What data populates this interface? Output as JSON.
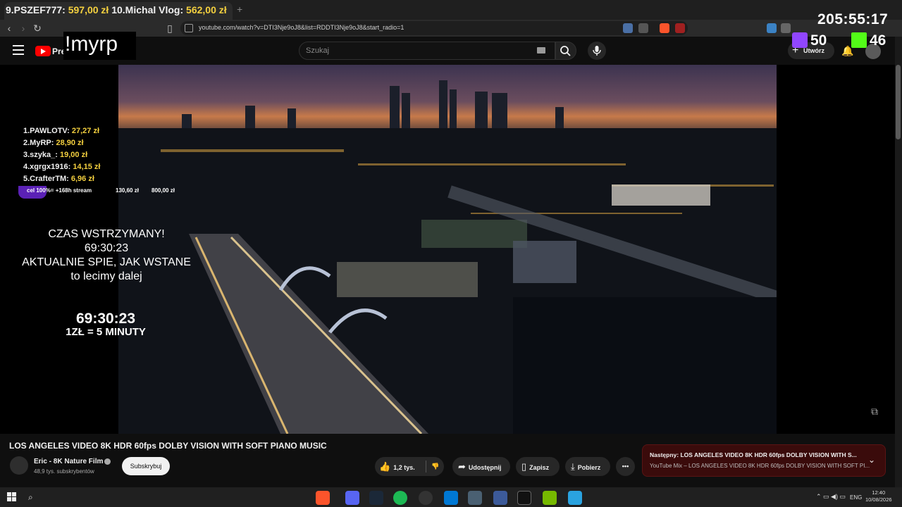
{
  "browser": {
    "url": "youtube.com/watch?v=DTI3Nje9oJ8&list=RDDTI3Nje9oJ8&start_radio=1",
    "new_tab": "+"
  },
  "youtube": {
    "logo_text": "Pre",
    "search_placeholder": "Szukaj",
    "create_label": "Utwórz"
  },
  "overlay": {
    "command": "!myrp",
    "clock": "205:55:17",
    "twitch_viewers": "50",
    "kick_viewers": "46",
    "top_ticker": [
      {
        "name": "9.PSZEF777:",
        "amount": "597,00 zł"
      },
      {
        "name": "10.Michal Vlog:",
        "amount": "562,00 zł"
      }
    ],
    "leaderboard": [
      {
        "name": "1.PAWLOTV:",
        "amount": "27,27 zł"
      },
      {
        "name": "2.MyRP:",
        "amount": "28,90 zł"
      },
      {
        "name": "3.szyka_:",
        "amount": "19,00 zł"
      },
      {
        "name": "4.xgrgx1916:",
        "amount": "14,15 zł"
      },
      {
        "name": "5.CrafterTM:",
        "amount": "6,96 zł"
      }
    ],
    "goal": {
      "label": "cel 100%= +168h stream",
      "current": "130,60 zł",
      "target": "800,00 zł",
      "progress": 0.163
    },
    "pause_lines": [
      "CZAS WSTRZYMANY!",
      "69:30:23",
      "AKTUALNIE SPIE, JAK WSTANE",
      "to lecimy dalej"
    ],
    "timer": "69:30:23",
    "rate": "1ZŁ = 5 MINUTY"
  },
  "video": {
    "title": "LOS ANGELES VIDEO 8K HDR 60fps DOLBY VISION WITH SOFT PIANO MUSIC",
    "channel": "Eric - 8K Nature Film",
    "subscribers": "48,9 tys. subskrybentów",
    "subscribe_label": "Subskrybuj",
    "likes": "1,2 tys.",
    "share_label": "Udostępnij",
    "save_label": "Zapisz",
    "download_label": "Pobierz",
    "more_label": "•••"
  },
  "up_next": {
    "line1": "Następny: LOS ANGELES VIDEO 8K HDR 60fps DOLBY VISION WITH S...",
    "line2": "YouTube Mix – LOS ANGELES VIDEO 8K HDR 60fps DOLBY VISION WITH SOFT PI..."
  },
  "taskbar": {
    "language": "ENG",
    "time": "12:40",
    "date": "10/08/2026"
  }
}
